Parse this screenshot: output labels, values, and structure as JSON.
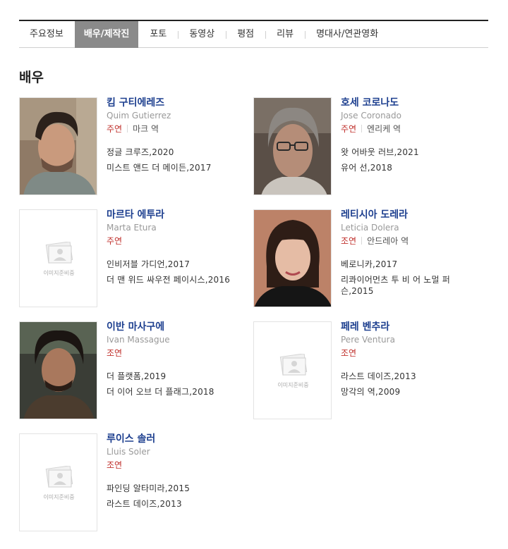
{
  "tabs": [
    "주요정보",
    "배우/제작진",
    "포토",
    "동영상",
    "평점",
    "리뷰",
    "명대사/연관영화"
  ],
  "section_title": "배우",
  "no_image_text": "이미지준비중",
  "actors": [
    {
      "name": "킴 구티에레즈",
      "ename": "Quim Gutierrez",
      "role": "주연",
      "character": "마크 역",
      "films": [
        "정글 크루즈,2020",
        "미스트 앤드 더 메이든,2017"
      ]
    },
    {
      "name": "호세 코로나도",
      "ename": "Jose Coronado",
      "role": "주연",
      "character": "엔리케 역",
      "films": [
        "왓 어바웃 러브,2021",
        "유어 선,2018"
      ]
    },
    {
      "name": "마르타 에투라",
      "ename": "Marta Etura",
      "role": "주연",
      "character": "",
      "films": [
        "인비저블 가디언,2017",
        "더 맨 위드 싸우전 페이시스,2016"
      ]
    },
    {
      "name": "레티시아 도레라",
      "ename": "Leticia Dolera",
      "role": "조연",
      "character": "안드레아 역",
      "films": [
        "베로니카,2017",
        "리콰이어먼츠 투 비 어 노멀 퍼",
        "슨,2015"
      ]
    },
    {
      "name": "이반 마사구에",
      "ename": "Ivan Massague",
      "role": "조연",
      "character": "",
      "films": [
        "더 플랫폼,2019",
        "더 이어 오브 더 플래그,2018"
      ]
    },
    {
      "name": "페레 벤추라",
      "ename": "Pere Ventura",
      "role": "조연",
      "character": "",
      "films": [
        "라스트 데이즈,2013",
        "망각의 역,2009"
      ]
    },
    {
      "name": "루이스 솔러",
      "ename": "Lluis Soler",
      "role": "조연",
      "character": "",
      "films": [
        "파인딩 알타미라,2015",
        "라스트 데이즈,2013"
      ]
    }
  ]
}
